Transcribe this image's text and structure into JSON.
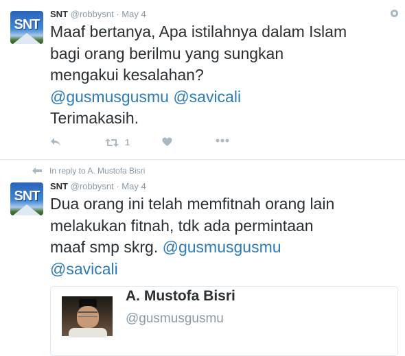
{
  "tweets": [
    {
      "avatar_text": "SNT",
      "name": "SNT",
      "handle": "@robbysnt",
      "separator": "·",
      "time": "May 4",
      "text_lines": [
        "Maaf bertanya, Apa istilahnya dalam Islam",
        "bagi orang berilmu yang sungkan",
        "mengakui kesalahan?"
      ],
      "mention_1": "@gusmusgusmu",
      "mention_2": "@savicali",
      "closing": "Terimakasih.",
      "retweet_count": "1",
      "icons": {
        "reply": "reply-icon",
        "retweet": "retweet-icon",
        "like": "heart-icon",
        "more": "more-icon",
        "globe": "globe-icon"
      }
    },
    {
      "reply_context": "In reply to A. Mustofa Bisri",
      "avatar_text": "SNT",
      "name": "SNT",
      "handle": "@robbysnt",
      "separator": "·",
      "time": "May 4",
      "text_lines": [
        "Dua orang ini telah memfitnah orang lain",
        "melakukan fitnah, tdk ada permintaan",
        "maaf smp skrg."
      ],
      "mention_1": "@gusmusgusmu",
      "mention_2": "@savicali",
      "card": {
        "name": "A. Mustofa Bisri",
        "handle": "@gusmusgusmu"
      }
    }
  ],
  "colors": {
    "link": "#2b7bb9",
    "meta": "#8899a6",
    "icon": "#aab8c2",
    "text": "#292f33"
  }
}
